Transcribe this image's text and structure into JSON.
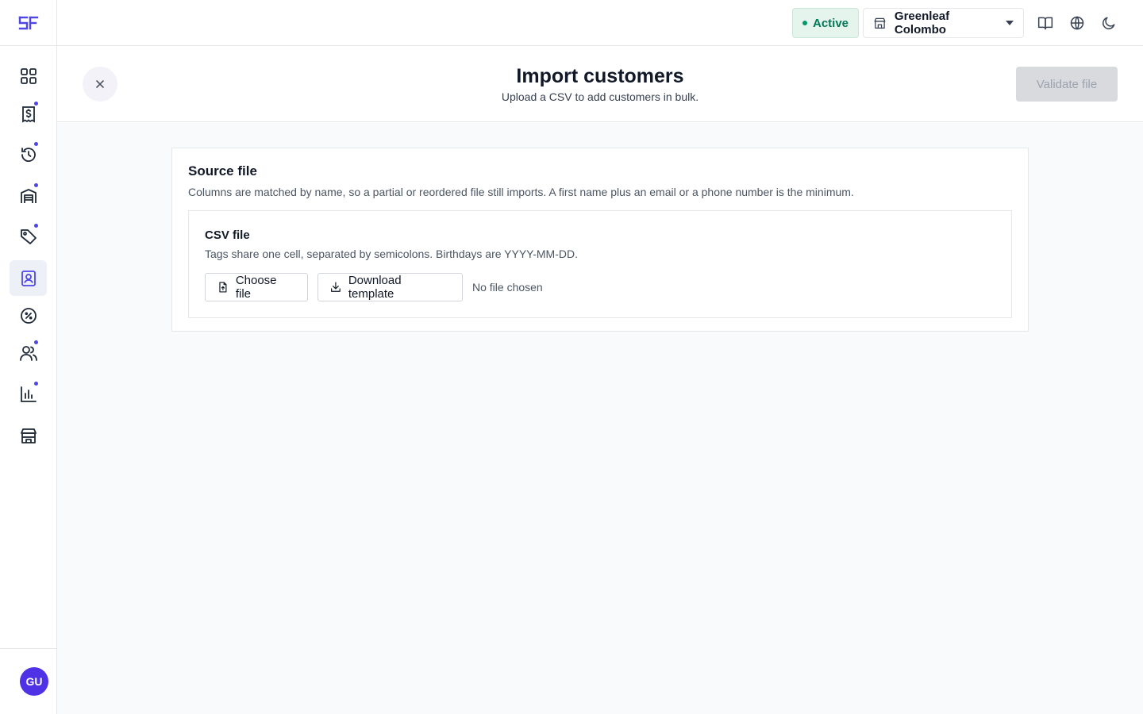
{
  "sidebar": {
    "logo": "SF",
    "items": [
      {
        "name": "dashboard",
        "icon": "grid-icon",
        "dot": false,
        "active": false
      },
      {
        "name": "sales",
        "icon": "receipt-dollar-icon",
        "dot": true,
        "active": false
      },
      {
        "name": "returns",
        "icon": "history-icon",
        "dot": true,
        "active": false
      },
      {
        "name": "inventory",
        "icon": "warehouse-icon",
        "dot": true,
        "active": false
      },
      {
        "name": "products",
        "icon": "tag-icon",
        "dot": true,
        "active": false
      },
      {
        "name": "customers",
        "icon": "contact-card-icon",
        "dot": false,
        "active": true
      },
      {
        "name": "discounts",
        "icon": "percent-badge-icon",
        "dot": false,
        "active": false
      },
      {
        "name": "staff",
        "icon": "users-icon",
        "dot": true,
        "active": false
      },
      {
        "name": "reports",
        "icon": "bar-chart-icon",
        "dot": true,
        "active": false
      },
      {
        "name": "stores",
        "icon": "store-icon",
        "dot": false,
        "active": false
      }
    ],
    "user_initials": "GU"
  },
  "topbar": {
    "status_label": "Active",
    "store_name": "Greenleaf Colombo",
    "icons": [
      "book-icon",
      "globe-icon",
      "moon-icon"
    ]
  },
  "header": {
    "title": "Import customers",
    "subtitle": "Upload a CSV to add customers in bulk.",
    "validate_label": "Validate file"
  },
  "source": {
    "title": "Source file",
    "description": "Columns are matched by name, so a partial or reordered file still imports. A first name plus an email or a phone number is the minimum.",
    "csv_title": "CSV file",
    "csv_description": "Tags share one cell, separated by semicolons. Birthdays are YYYY-MM-DD.",
    "choose_label": "Choose file",
    "template_label": "Download template",
    "file_status": "No file chosen"
  },
  "colors": {
    "accent": "#4f46e5",
    "avatar": "#4f31e6",
    "status_green": "#047857"
  }
}
